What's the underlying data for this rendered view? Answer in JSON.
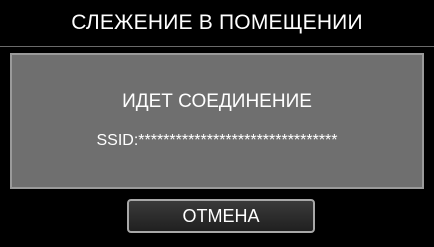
{
  "header": {
    "title": "СЛЕЖЕНИЕ В ПОМЕЩЕНИИ"
  },
  "dialog": {
    "status_text": "ИДЕТ СОЕДИНЕНИЕ",
    "ssid_text": "SSID:********************************"
  },
  "actions": {
    "cancel_label": "ОТМЕНА"
  },
  "colors": {
    "background": "#000000",
    "panel": "#6f6f6f",
    "panel_border": "#9a9a9a",
    "button_border": "#a8a8a8",
    "text": "#ffffff"
  }
}
